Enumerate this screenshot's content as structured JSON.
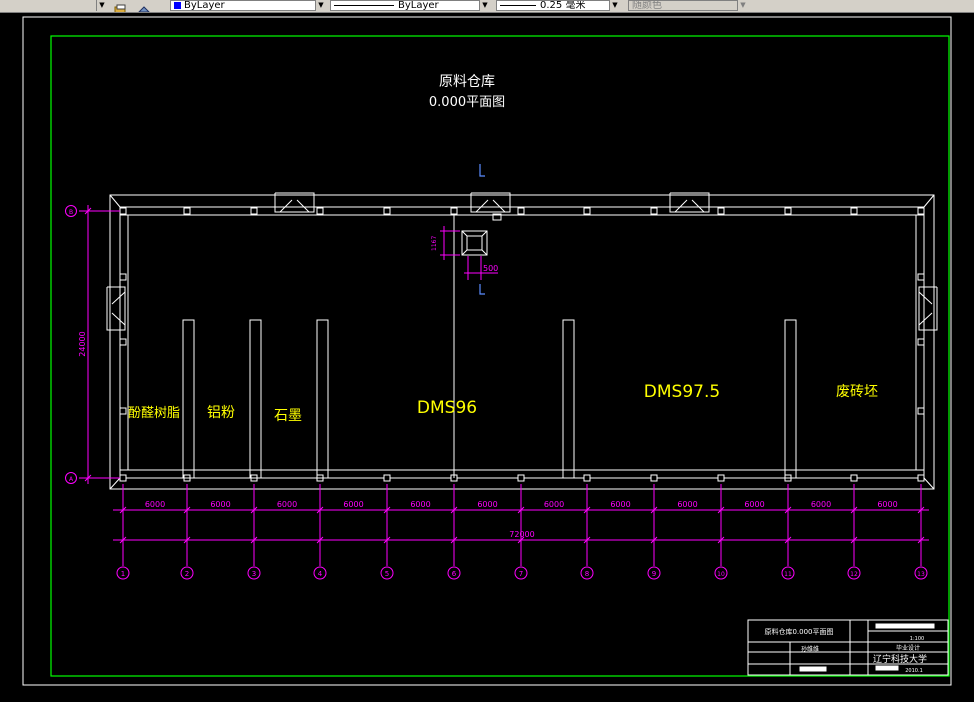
{
  "toolbar": {
    "layer_color": "ByLayer",
    "linetype": "ByLayer",
    "lineweight": "0.25 毫米",
    "plot_style": "随颜色"
  },
  "drawing": {
    "title": "原料仓库",
    "subtitle": "0.000平面图",
    "height_dim": "24000",
    "total_dim": "72000",
    "bay_dim": "6000",
    "dim_500": "500",
    "dim_small": "1167",
    "rooms": [
      {
        "label": "酚醛树脂"
      },
      {
        "label": "铝粉"
      },
      {
        "label": "石墨"
      },
      {
        "label": "DMS96"
      },
      {
        "label": "DMS97.5"
      },
      {
        "label": "废砖坯"
      }
    ],
    "axis_numbers": [
      "1",
      "2",
      "3",
      "4",
      "5",
      "6",
      "7",
      "8",
      "9",
      "10",
      "11",
      "12",
      "13"
    ],
    "row_letters": [
      "A",
      "B"
    ]
  },
  "title_block": {
    "drawing_name": "原料仓库0.000平面图",
    "scale": "1:100",
    "stage": "毕业设计",
    "designer": "孙维维",
    "university": "辽宁科技大学",
    "date": "2010.1"
  },
  "colors": {
    "background": "#000000",
    "frame": "#00ff00",
    "walls": "#ffffff",
    "dimensions": "#ff00ff",
    "room_labels": "#ffff00",
    "title_text": "#ffffff"
  }
}
